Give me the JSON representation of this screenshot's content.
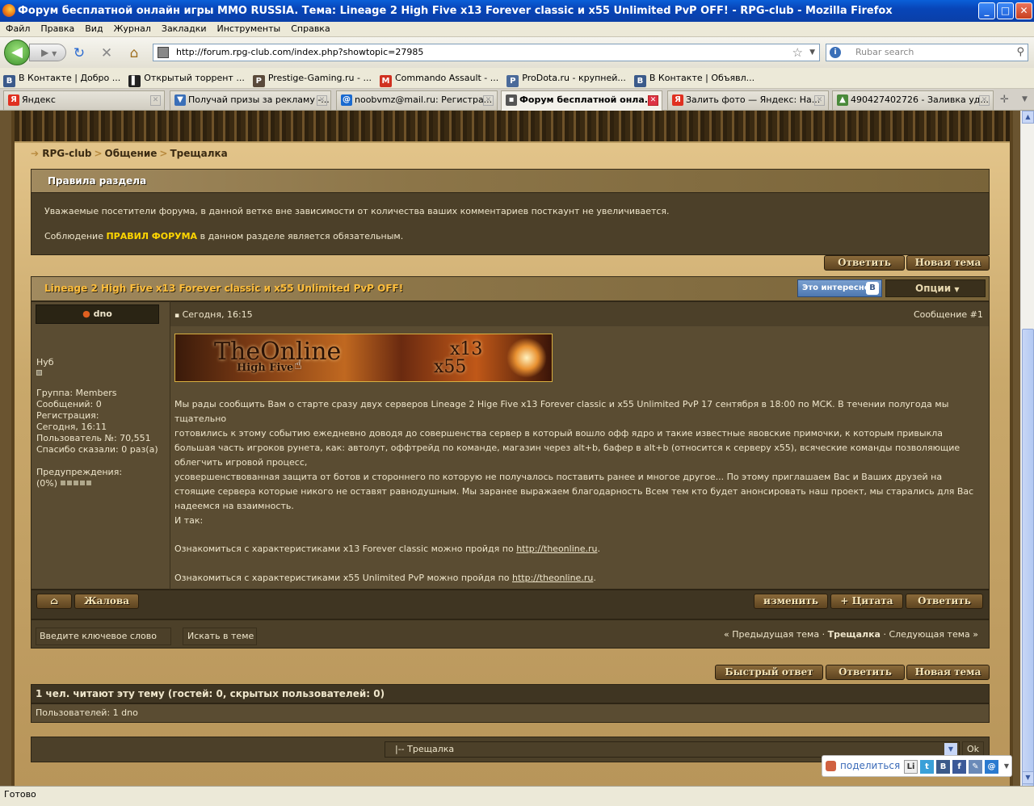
{
  "window": {
    "title": "Форум бесплатной онлайн игры MMO RUSSIA. Тема: Lineage 2 High Five x13 Forever classic и x55 Unlimited PvP OFF! - RPG-club - Mozilla Firefox",
    "minimize": "_",
    "maximize": "□",
    "close": "✕"
  },
  "menu": [
    "Файл",
    "Правка",
    "Вид",
    "Журнал",
    "Закладки",
    "Инструменты",
    "Справка"
  ],
  "nav": {
    "url": "http://forum.rpg-club.com/index.php?showtopic=27985",
    "search_placeholder": "Rubar search"
  },
  "bookmarks": [
    {
      "label": "В Контакте | Добро ...",
      "icon": "vk-icon",
      "color": "#3b5a8a",
      "glyph": "В"
    },
    {
      "label": "Открытый торрент ...",
      "icon": "barcode-icon",
      "color": "#222",
      "glyph": "▌"
    },
    {
      "label": "Prestige-Gaming.ru - ...",
      "icon": "pg-icon",
      "color": "#5a4a3a",
      "glyph": "P"
    },
    {
      "label": "Commando Assault - ...",
      "icon": "gmail-icon",
      "color": "#d03020",
      "glyph": "M"
    },
    {
      "label": "ProDota.ru - крупней...",
      "icon": "pd-icon",
      "color": "#4a6a9a",
      "glyph": "P"
    },
    {
      "label": "В Контакте | Объявл...",
      "icon": "vk-icon",
      "color": "#3b5a8a",
      "glyph": "В"
    }
  ],
  "tabs": [
    {
      "label": "Яндекс",
      "color": "#e03020",
      "glyph": "Я",
      "active": false
    },
    {
      "label": "Получай призы за рекламу -...",
      "color": "#3a6fb8",
      "glyph": "▼",
      "active": false
    },
    {
      "label": "noobvmz@mail.ru: Регистра...",
      "color": "#1a6ad0",
      "glyph": "@",
      "active": false
    },
    {
      "label": "Форум бесплатной онла...",
      "color": "#555",
      "glyph": "▪",
      "active": true
    },
    {
      "label": "Залить фото — Яндекс: На...",
      "color": "#e03020",
      "glyph": "Я",
      "active": false
    },
    {
      "label": "490427402726 - Заливка уд...",
      "color": "#4a8a3a",
      "glyph": "▲",
      "active": false
    }
  ],
  "status": "Готово",
  "breadcrumb": {
    "items": [
      "RPG-club",
      "Общение",
      "Трещалка"
    ]
  },
  "rules": {
    "title": "Правила раздела",
    "line1": "Уважаемые посетители форума, в данной ветке вне зависимости от количества ваших комментариев посткаунт не увеличивается.",
    "line2_pre": "Соблюдение",
    "line2_link": "ПРАВИЛ ФОРУМА",
    "line2_post": "в данном разделе является обязательным."
  },
  "buttons": {
    "reply": "Ответить",
    "new_topic": "Новая тема",
    "fast_reply": "Быстрый ответ",
    "edit": "изменить",
    "quote": "+ Цитата",
    "complaint": "Жалова",
    "home": "⌂"
  },
  "topic": {
    "title": "Lineage 2 High Five x13 Forever classic и x55 Unlimited PvP OFF!",
    "interesting": "Это интересно",
    "vk": "В",
    "options": "Опции"
  },
  "post": {
    "author": "dno",
    "date": "Сегодня, 16:15",
    "number": "Сообщение #1",
    "rank": "Нуб",
    "group": "Группа: Members",
    "messages": "Сообщений: 0",
    "reg_label": "Регистрация:",
    "reg_date": "Сегодня, 16:11",
    "user_no": "Пользователь №: 70,551",
    "thanks": "Спасибо сказали: 0 раз(а)",
    "warn_label": "Предупреждения:",
    "warn_value": "(0%)",
    "banner_title": "TheOnline",
    "banner_sub": "High Five",
    "banner_x13": "x13",
    "banner_x55": "x55",
    "p1": "Мы рады сообщить Вам о старте сразу двух серверов Lineage 2 Hige Five x13 Forever classic и x55 Unlimited PvP 17 сентября в 18:00 по МСК. В течении полугода мы тщательно",
    "p2": "готовились к этому событию ежедневно доводя до совершенства сервер в который вошло офф ядро и такие известные явовские примочки, к которым привыкла большая часть игроков рунета, как: автолут, оффтрейд по команде, магазин через alt+b, бафер в alt+b (относится к серверу x55), всяческие команды позволяющие облегчить игровой процесс,",
    "p3": "усовершенствованная защита от ботов и стороннего по которую не получалось поставить ранее и многое другое... По этому приглашаем Вас и Ваших друзей на стоящие сервера которые никого не оставят равнодушным. Мы заранее выражаем благодарность Всем тем кто будет анонсировать наш проект, мы старались для Вас надеемся на взаимность.",
    "p4": "И так:",
    "l1_pre": "Ознакомиться с характеристиками x13 Forever classic можно пройдя по",
    "l1_link": "http://theonline.ru",
    "l2_pre": "Ознакомиться с характеристиками x55 Unlimited PvP можно пройдя по",
    "l2_link": "http://theonline.ru",
    "dot": "."
  },
  "search": {
    "keyword": "Введите ключевое слово",
    "button": "Искать в теме"
  },
  "topicnav": {
    "prev": "« Предыдущая тема",
    "sep": "·",
    "current": "Трещалка",
    "next": "Следующая тема »"
  },
  "readers": {
    "title": "1 чел. читают эту тему (гостей: 0, скрытых пользователей: 0)",
    "users": "Пользователей: 1 dno"
  },
  "jump": {
    "selected": "|-- Трещалка",
    "ok": "Ok"
  },
  "share": {
    "label": "поделиться",
    "icons": [
      "Li",
      "t",
      "В",
      "f",
      "✎",
      "@"
    ]
  }
}
